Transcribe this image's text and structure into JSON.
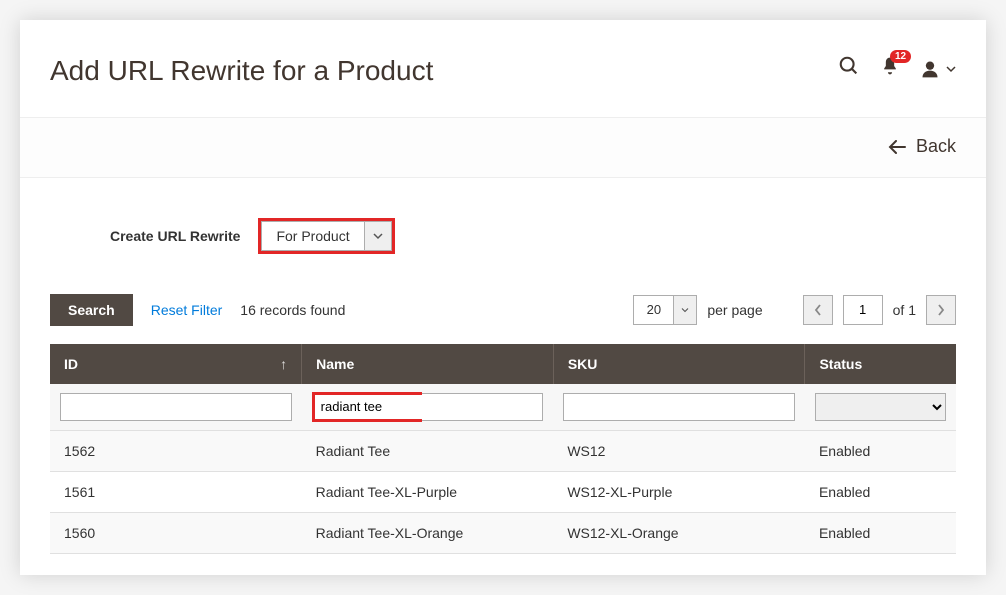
{
  "header": {
    "title": "Add URL Rewrite for a Product",
    "notification_count": "12"
  },
  "action_bar": {
    "back_label": "Back"
  },
  "form": {
    "label": "Create URL Rewrite",
    "selected": "For Product"
  },
  "grid_controls": {
    "search_label": "Search",
    "reset_label": "Reset Filter",
    "records_found": "16 records found",
    "page_size": "20",
    "per_page_label": "per page",
    "current_page": "1",
    "of_label": "of 1"
  },
  "columns": {
    "id": "ID",
    "name": "Name",
    "sku": "SKU",
    "status": "Status"
  },
  "filters": {
    "id": "",
    "name": "radiant tee",
    "sku": "",
    "status": ""
  },
  "rows": [
    {
      "id": "1562",
      "name": "Radiant Tee",
      "sku": "WS12",
      "status": "Enabled"
    },
    {
      "id": "1561",
      "name": "Radiant Tee-XL-Purple",
      "sku": "WS12-XL-Purple",
      "status": "Enabled"
    },
    {
      "id": "1560",
      "name": "Radiant Tee-XL-Orange",
      "sku": "WS12-XL-Orange",
      "status": "Enabled"
    }
  ]
}
